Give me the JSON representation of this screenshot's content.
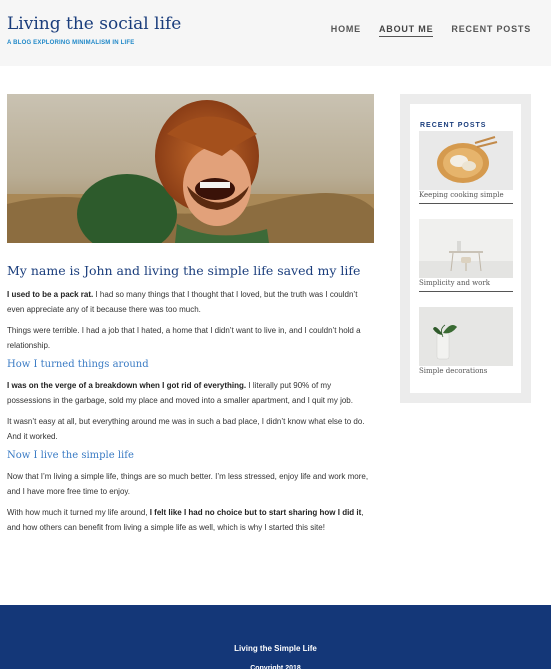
{
  "site": {
    "title": "Living the social life",
    "tagline": "A BLOG EXPLORING MINIMALISM IN LIFE"
  },
  "nav": {
    "items": [
      "HOME",
      "ABOUT ME",
      "RECENT POSTS"
    ],
    "active": "ABOUT ME"
  },
  "post": {
    "title": "My name is John and living the simple life saved my life",
    "p1_bold": "I used to be a pack rat.",
    "p1_rest": " I had so many things that I thought that I loved, but the truth was I couldn’t even appreciate any of it because there was too much.",
    "p2": "Things were terrible. I had a job that I hated, a home that I didn’t want to live in, and I couldn’t hold a relationship.",
    "h2a": "How I turned things around",
    "p3_bold": "I was on the verge of a breakdown when I got rid of everything.",
    "p3_rest": " I literally put 90% of my possessions in the garbage, sold my place and moved into a smaller apartment, and I quit my job.",
    "p4": "It wasn’t easy at all, but everything around me was in such a bad place, I didn’t know what else to do. And it worked.",
    "h2b": "Now I live the simple life",
    "p5": "Now that I’m living a simple life, things are so much better. I’m less stressed, enjoy life and work more, and I have more free time to enjoy.",
    "p6_start": "With how much it turned my life around, ",
    "p6_bold": "I felt like I had no choice but to start sharing how I did it",
    "p6_end": ", and how others can benefit from living a simple life as well, which is why I started this site!"
  },
  "sidebar": {
    "title": "RECENT POSTS",
    "posts": [
      {
        "caption": "Keeping cooking simple"
      },
      {
        "caption": "Simplicity and work"
      },
      {
        "caption": "Simple decorations"
      }
    ]
  },
  "footer": {
    "title": "Living the Simple Life",
    "copyright": "Copyright 2018"
  },
  "colors": {
    "brand": "#1a3d7c",
    "accent": "#3a7bc4",
    "footer": "#143778"
  }
}
